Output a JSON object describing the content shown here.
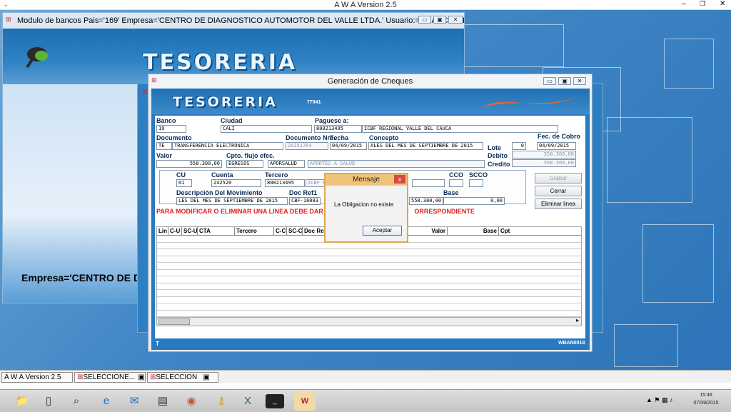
{
  "app": {
    "title": "A W A Version 2.5"
  },
  "modulo": {
    "title": "Modulo de bancos  Pais='169'  Empresa='CENTRO DE DIAGNOSTICO AUTOMOTOR DEL VALLE LTDA.'   Usuario:='FRANCIA ELENA ...",
    "logo": "TESORERIA",
    "empresa": "Empresa='CENTRO DE DI"
  },
  "cheques": {
    "title": "Generación de Cheques",
    "logo": "TESORERIA",
    "code": "77941",
    "footer_left": "T",
    "footer_right": "WBAN0018",
    "banco": {
      "label": "Banco",
      "value": "19"
    },
    "ciudad": {
      "label": "Ciudad",
      "value": "CALI"
    },
    "paguese": {
      "label": "Paguese a:",
      "nit": "800213495",
      "name": "ICBF REGIONAL VALLE DEL CAUCA"
    },
    "documento": {
      "label": "Documento",
      "type": "TE",
      "desc": "TRANSFERENCIA ELECTRONICA"
    },
    "doc_nro": {
      "label": "Documento Nro.",
      "value": "20151764"
    },
    "fecha": {
      "label": "Fecha",
      "value": "04/09/2015"
    },
    "concepto": {
      "label": "Concepto",
      "value": "ALES  DEL MES DE SEPTIEMBRE DE 2015"
    },
    "lote": {
      "label": "Lote",
      "value": "0"
    },
    "fec_cobro": {
      "label": "Fec. de Cobro",
      "value": "04/09/2015"
    },
    "valor": {
      "label": "Valor",
      "value": "558.300,00"
    },
    "cpto_flujo": {
      "label": "Cpto. flujo efec.",
      "value": "EGRESOS"
    },
    "aporsalud": {
      "code": "APORSALUD",
      "desc": "APORTES A SALUD"
    },
    "debito": {
      "label": "Debito",
      "value": "558.300,00"
    },
    "credito": {
      "label": "Credito",
      "value": "558.300,00"
    },
    "cu": {
      "label": "CU",
      "value": "01"
    },
    "cuenta": {
      "label": "Cuenta",
      "value": "242520"
    },
    "tercero": {
      "label": "Tercero",
      "nit": "800213495",
      "name": "ICBF REGIONAL"
    },
    "cco": {
      "label": "CCO"
    },
    "scco": {
      "label": "SCCO"
    },
    "desc_mov": {
      "label": "Descripción Del Movimiento",
      "value": "LES  DEL MES DE SEPTIEMBRE DE 2015"
    },
    "doc_ref1": {
      "label": "Doc Ref1",
      "value": "CBF-16083"
    },
    "valor_mov": {
      "value": "558.300,00"
    },
    "base": {
      "label": "Base",
      "value": "0,00"
    },
    "buttons": {
      "grabar": "Grabar",
      "cerrar": "Cerrar",
      "eliminar": "Eliminar linea"
    },
    "warning": "PARA MODIFICAR O ELIMINAR UNA LINEA DEBE DAR CLIC",
    "warning_tail": "ORRESPONDIENTE",
    "grid_headers": [
      "Lin",
      "C-U",
      "SC-U",
      "CTA",
      "Tercero",
      "C-C",
      "SC-C",
      "Doc Ref1",
      "",
      "",
      "Valor",
      "Base",
      "Cpt"
    ]
  },
  "message": {
    "title": "Mensaje",
    "text": "La Obligacion no existe",
    "ok": "Aceptar",
    "close": "x"
  },
  "tasks": [
    "A W A Version 2.5",
    "SELECCIONE...",
    "SELECCION"
  ],
  "clock": {
    "time": "15:48",
    "date": "07/09/2015"
  }
}
